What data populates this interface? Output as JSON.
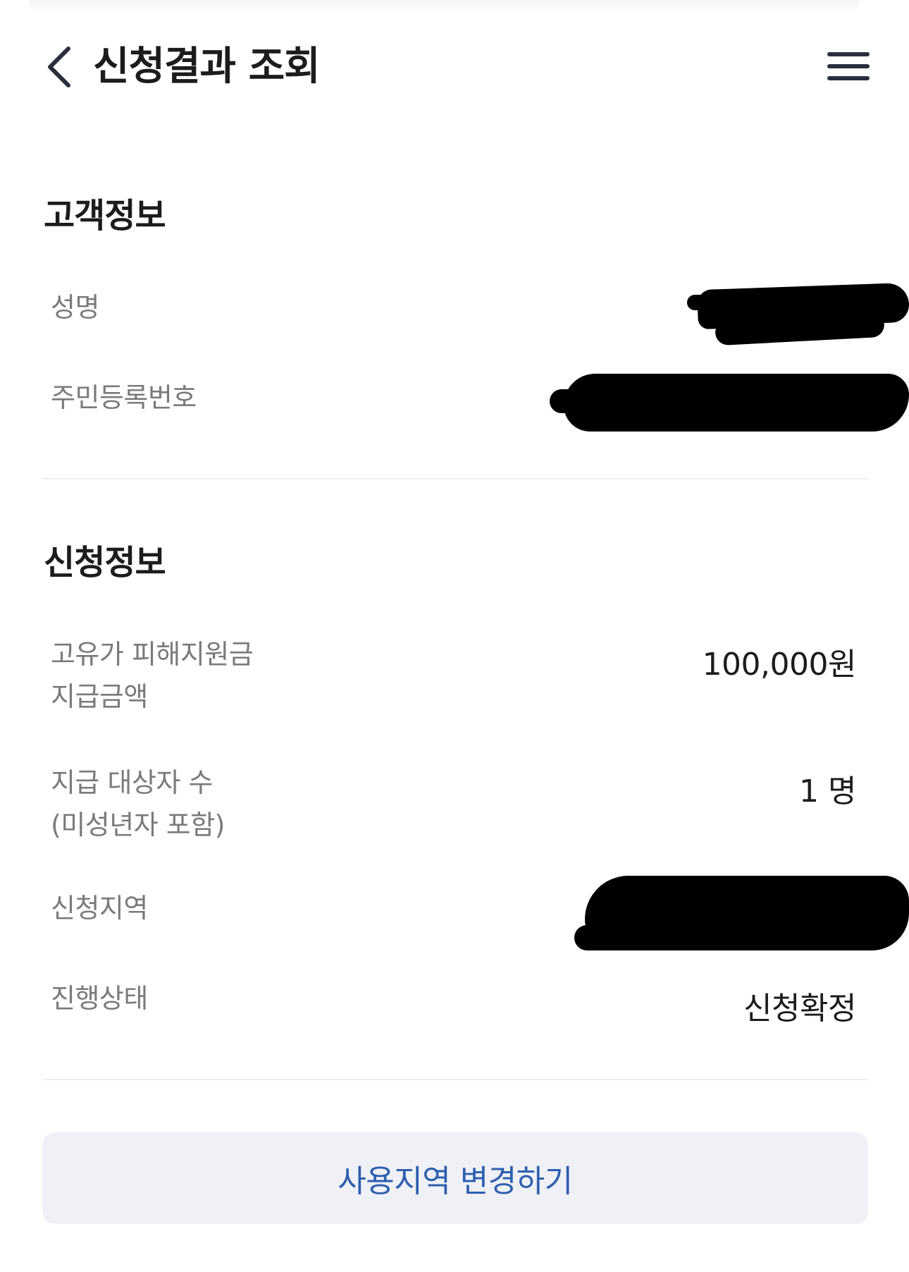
{
  "header": {
    "title": "신청결과 조회"
  },
  "customer": {
    "section_title": "고객정보",
    "name_label": "성명",
    "id_label": "주민등록번호"
  },
  "application": {
    "section_title": "신청정보",
    "amount_label_line1": "고유가 피해지원금",
    "amount_label_line2": "지급금액",
    "amount_value": "100,000원",
    "recipients_label_line1": "지급 대상자 수",
    "recipients_label_line2": "(미성년자 포함)",
    "recipients_value": "1 명",
    "region_label": "신청지역",
    "status_label": "진행상태",
    "status_value": "신청확정"
  },
  "action": {
    "change_region_label": "사용지역 변경하기"
  },
  "colors": {
    "accent_text": "#2e5eae",
    "button_bg": "#eff1f7",
    "label_gray": "#7a7a7a"
  }
}
